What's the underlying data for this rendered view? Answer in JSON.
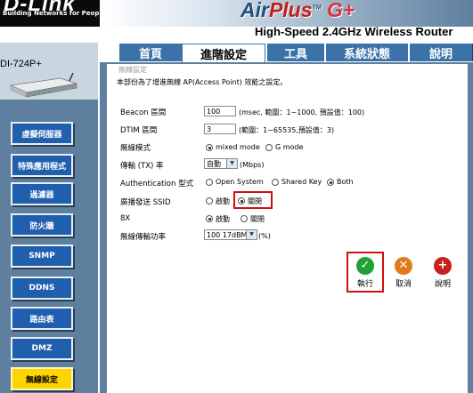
{
  "header": {
    "logo": "D-Link",
    "tagline": "Building Networks for People",
    "brand_air": "Air",
    "brand_plus": "Plus",
    "brand_tm": "TM",
    "brand_g": "G+",
    "subtitle": "High-Speed 2.4GHz Wireless Router"
  },
  "model": {
    "name": "DI-724P+"
  },
  "tabs": [
    {
      "label": "首頁",
      "active": false
    },
    {
      "label": "進階設定",
      "active": true
    },
    {
      "label": "工具",
      "active": false
    },
    {
      "label": "系統狀態",
      "active": false
    },
    {
      "label": "說明",
      "active": false
    }
  ],
  "sidebar": {
    "items": [
      {
        "label": "虛擬伺服器",
        "active": false
      },
      {
        "label": "特殊應用程式",
        "active": false
      },
      {
        "label": "過濾器",
        "active": false
      },
      {
        "label": "防火牆",
        "active": false
      },
      {
        "label": "SNMP",
        "active": false
      },
      {
        "label": "DDNS",
        "active": false
      },
      {
        "label": "路由表",
        "active": false
      },
      {
        "label": "DMZ",
        "active": false
      },
      {
        "label": "無線設定",
        "active": true
      }
    ]
  },
  "section": {
    "title": "無線設定",
    "description": "本部份為了增進無線 AP(Access Point) 效能之設定。"
  },
  "form": {
    "beacon": {
      "label": "Beacon 區間",
      "value": "100",
      "note": "(msec, 範圍：1~1000, 預設值：100)"
    },
    "dtim": {
      "label": "DTIM 區間",
      "value": "3",
      "note": "(範圍：1~65535,預設值：3)"
    },
    "wireless_mode": {
      "label": "無線模式",
      "options": [
        "mixed mode",
        "G mode"
      ],
      "selected": "mixed mode"
    },
    "tx_rate": {
      "label": "傳輸 (TX) 率",
      "value": "自動",
      "unit": "(Mbps)"
    },
    "auth": {
      "label": "Authentication 型式",
      "options": [
        "Open System",
        "Shared Key",
        "Both"
      ],
      "selected": "Both"
    },
    "ssid_broadcast": {
      "label": "廣播發送 SSID",
      "options": [
        "啟動",
        "關閉"
      ],
      "selected": "關閉"
    },
    "eight_x": {
      "label": "8X",
      "options": [
        "啟動",
        "關閉"
      ],
      "selected": "啟動"
    },
    "tx_power": {
      "label": "無線傳輸功率",
      "value": "100 17dBM",
      "unit": "(%)"
    }
  },
  "actions": {
    "apply": "執行",
    "cancel": "取消",
    "help": "說明"
  },
  "colors": {
    "panel_blue": "#5f7f9f",
    "tab_blue": "#3b72a8",
    "nav_blue": "#1f5fae",
    "nav_active": "#ffd400",
    "highlight_red": "#d01010",
    "apply_green": "#22a03a",
    "cancel_orange": "#e07a1a",
    "help_red": "#c8201c"
  }
}
